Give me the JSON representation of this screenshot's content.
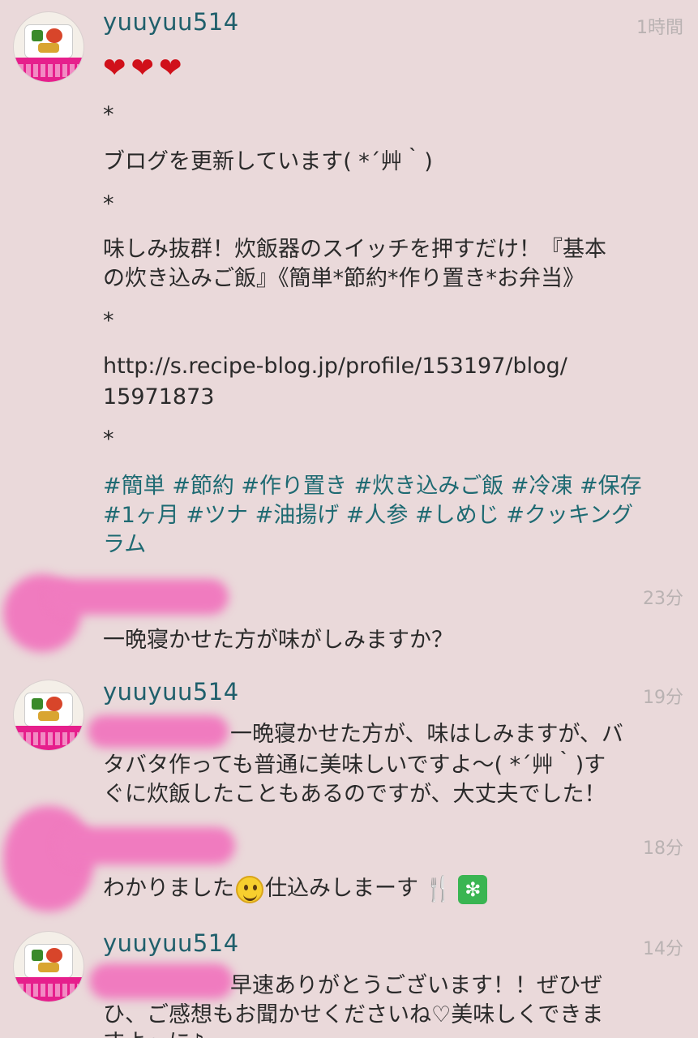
{
  "post": {
    "username": "yuuyuu514",
    "time": "1時間",
    "hearts": "❤❤❤",
    "lines": [
      "*",
      "ブログを更新しています( *´艸｀)",
      "*",
      "味しみ抜群！炊飯器のスイッチを押すだけ！『基本",
      "の炊き込みご飯』《簡単*節約*作り置き*お弁当》",
      "*",
      "http://s.recipe-blog.jp/profile/153197/blog/",
      "15971873",
      "*"
    ],
    "tag_lines": [
      "#簡単 #節約 #作り置き #炊き込みご飯 #冷凍 #保存",
      "#1ヶ月 #ツナ #油揚げ #人参 #しめじ #クッキング",
      "ラム"
    ]
  },
  "comments": [
    {
      "time": "23分",
      "lines": [
        "一晩寝かせた方が味がしみますか？"
      ]
    },
    {
      "username": "yuuyuu514",
      "time": "19分",
      "lines": [
        "一晩寝かせた方が、味はしみますが、バ",
        "タバタ作っても普通に美味しいですよ〜( *´艸｀)す",
        "ぐに炊飯したこともあるのですが、大丈夫でした！"
      ]
    },
    {
      "time": "18分",
      "text_before": "わかりました",
      "text_after": "仕込みしまーす",
      "emoji_fork": "🍴",
      "emoji_sparkle": "❇"
    },
    {
      "username": "yuuyuu514",
      "time": "14分",
      "lines": [
        "早速ありがとうございます！！ぜひぜ",
        "ひ、ご感想もお聞かせくださいね♡美味しくできま",
        "すよ〜に♪"
      ]
    }
  ],
  "colors": {
    "background": "#ead9da",
    "username": "#1f5f6b",
    "hashtag": "#1e6a72",
    "timestamp": "#b9b2b2",
    "redaction": "#f07bbf"
  }
}
